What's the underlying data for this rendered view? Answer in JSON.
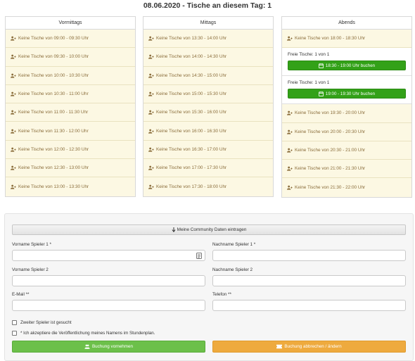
{
  "header": {
    "title": "08.06.2020 - Tische an diesem Tag: 1"
  },
  "columns": [
    {
      "title": "Vormittags",
      "slots": [
        {
          "type": "none",
          "text": "Keine Tische von 09:00 - 09:30 Uhr"
        },
        {
          "type": "none",
          "text": "Keine Tische von 09:30 - 10:00 Uhr"
        },
        {
          "type": "none",
          "text": "Keine Tische von 10:00 - 10:30 Uhr"
        },
        {
          "type": "none",
          "text": "Keine Tische von 10:30 - 11:00 Uhr"
        },
        {
          "type": "none",
          "text": "Keine Tische von 11:00 - 11:30 Uhr"
        },
        {
          "type": "none",
          "text": "Keine Tische von 11:30 - 12:00 Uhr"
        },
        {
          "type": "none",
          "text": "Keine Tische von 12:00 - 12:30 Uhr"
        },
        {
          "type": "none",
          "text": "Keine Tische von 12:30 - 13:00 Uhr"
        },
        {
          "type": "none",
          "text": "Keine Tische von 13:00 - 13:30 Uhr"
        }
      ]
    },
    {
      "title": "Mittags",
      "slots": [
        {
          "type": "none",
          "text": "Keine Tische von 13:30 - 14:00 Uhr"
        },
        {
          "type": "none",
          "text": "Keine Tische von 14:00 - 14:30 Uhr"
        },
        {
          "type": "none",
          "text": "Keine Tische von 14:30 - 15:00 Uhr"
        },
        {
          "type": "none",
          "text": "Keine Tische von 15:00 - 15:30 Uhr"
        },
        {
          "type": "none",
          "text": "Keine Tische von 15:30 - 16:00 Uhr"
        },
        {
          "type": "none",
          "text": "Keine Tische von 16:00 - 16:30 Uhr"
        },
        {
          "type": "none",
          "text": "Keine Tische von 16:30 - 17:00 Uhr"
        },
        {
          "type": "none",
          "text": "Keine Tische von 17:00 - 17:30 Uhr"
        },
        {
          "type": "none",
          "text": "Keine Tische von 17:30 - 18:00 Uhr"
        }
      ]
    },
    {
      "title": "Abends",
      "slots": [
        {
          "type": "none",
          "text": "Keine Tische von 18:00 - 18:30 Uhr"
        },
        {
          "type": "free",
          "text": "Freie Tische: 1 von 1",
          "button": "18:30 - 19:00 Uhr buchen"
        },
        {
          "type": "free",
          "text": "Freie Tische: 1 von 1",
          "button": "19:00 - 19:30 Uhr buchen"
        },
        {
          "type": "none",
          "text": "Keine Tische von 19:30 - 20:00 Uhr"
        },
        {
          "type": "none",
          "text": "Keine Tische von 20:00 - 20:30 Uhr"
        },
        {
          "type": "none",
          "text": "Keine Tische von 20:30 - 21:00 Uhr"
        },
        {
          "type": "none",
          "text": "Keine Tische von 21:00 - 21:30 Uhr"
        },
        {
          "type": "none",
          "text": "Keine Tische von 21:30 - 22:00 Uhr"
        }
      ]
    }
  ],
  "form": {
    "community_button": "Meine Community Daten eintragen",
    "fields": {
      "first_name_1": {
        "label": "Vorname Spieler 1 *",
        "value": ""
      },
      "last_name_1": {
        "label": "Nachname Spieler 1 *",
        "value": ""
      },
      "first_name_2": {
        "label": "Vorname Spieler 2",
        "value": ""
      },
      "last_name_2": {
        "label": "Nachname Spieler 2",
        "value": ""
      },
      "email": {
        "label": "E-Mail **",
        "value": ""
      },
      "phone": {
        "label": "Telefon **",
        "value": ""
      }
    },
    "checkboxes": {
      "second_player": "Zweiter Spieler ist gesucht",
      "publish_consent": "* Ich akzeptiere die Veröffentlichung meines Namens im Stundenplan."
    },
    "submit_button": "Buchung vornehmen",
    "cancel_button": "Buchung abbrechen / ändern"
  },
  "colors": {
    "slot_bg": "#fcf8e3",
    "slot_text": "#8a6d3b",
    "book_green": "#33a118",
    "submit_green": "#6cc04a",
    "cancel_orange": "#eeaa3e"
  },
  "icons": {
    "slot": "user-plus-icon",
    "book": "calendar-icon",
    "community": "arrow-down-icon",
    "card": "contact-card-icon",
    "submit": "users-icon",
    "cancel": "ticket-icon"
  }
}
